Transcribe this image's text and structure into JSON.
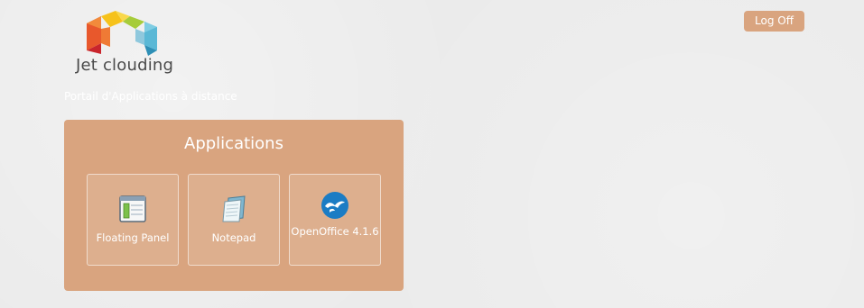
{
  "header": {
    "logo_text": "Jet clouding",
    "logoff_label": "Log Off",
    "subtitle": "Portail d'Applications à distance"
  },
  "applications": {
    "title": "Applications",
    "items": [
      {
        "label": "Floating Panel",
        "icon": "floating-panel-icon"
      },
      {
        "label": "Notepad",
        "icon": "notepad-icon"
      },
      {
        "label": "OpenOffice 4.1.6",
        "icon": "openoffice-icon"
      }
    ]
  },
  "colors": {
    "accent": "#d9a47f",
    "background": "#ebebeb"
  }
}
